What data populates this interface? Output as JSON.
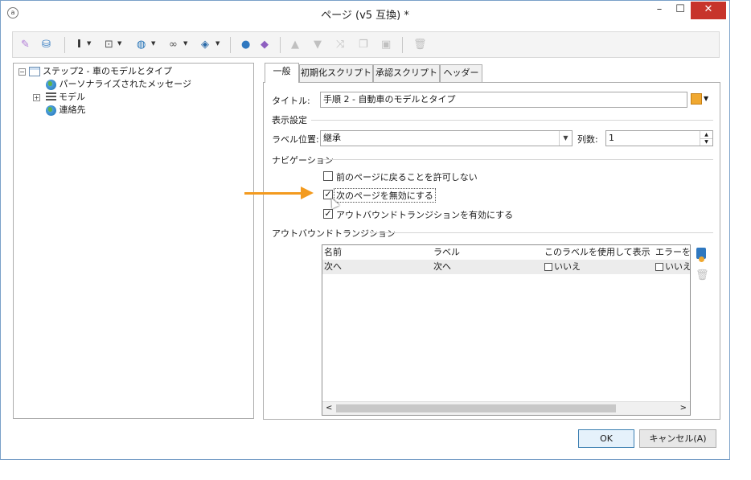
{
  "window": {
    "title": "ページ (v5 互換) *",
    "app_icon": "a",
    "minimize": "–",
    "maximize": "☐",
    "close": "✕"
  },
  "toolbar": {
    "icons": [
      "wand-icon",
      "database-icon",
      "text-cursor-icon",
      "flow-icon",
      "globe-icon",
      "link-icon",
      "stack-icon",
      "person-icon",
      "shapes-icon",
      "arrow-up-icon",
      "arrow-down-icon",
      "shuffle-icon",
      "copy-icon",
      "paste-icon",
      "trash-icon"
    ],
    "glyphs": {
      "wand": "✎",
      "database": "⛁",
      "text": "I",
      "flow": "⊡",
      "globe": "◍",
      "link": "∞",
      "stack": "◈",
      "person": "●",
      "shapes": "◆",
      "up": "▲",
      "down": "▼",
      "shuffle": "⤨",
      "copy": "❐",
      "paste": "▣",
      "trash": "🗑",
      "dd": "▼"
    }
  },
  "tree": {
    "root": {
      "label": "ステップ2 - 車のモデルとタイプ",
      "expander": "⊟"
    },
    "items": [
      {
        "label": "パーソナライズされたメッセージ"
      },
      {
        "label": "モデル",
        "expander": "+"
      },
      {
        "label": "連絡先"
      }
    ]
  },
  "tabs": [
    "一般",
    "初期化スクリプト",
    "承認スクリプト",
    "ヘッダー"
  ],
  "general": {
    "title_label": "タイトル:",
    "title_value": "手順 2 - 自動車のモデルとタイプ",
    "display_settings": "表示設定",
    "label_position_label": "ラベル位置:",
    "label_position_value": "継承",
    "columns_label": "列数:",
    "columns_value": "1",
    "navigation": "ナビゲーション",
    "nav_options": [
      {
        "label": "前のページに戻ることを許可しない",
        "checked": false
      },
      {
        "label": "次のページを無効にする",
        "checked": true
      },
      {
        "label": "アウトバウンドトランジションを有効にする",
        "checked": true
      }
    ],
    "check_mark": "✓",
    "outbound": "アウトバウンドトランジション",
    "grid": {
      "columns": [
        "名前",
        "ラベル",
        "このラベルを使用して表示",
        "エラーを無"
      ],
      "rows": [
        {
          "name": "次へ",
          "label": "次へ",
          "use_label": "いいえ",
          "error": "いいえ"
        }
      ],
      "scroll_left": "<",
      "scroll_right": ">"
    }
  },
  "buttons": {
    "ok": "OK",
    "cancel": "キャンセル(A)"
  },
  "colors": {
    "accent_arrow": "#f39a1e",
    "close_red": "#c7342b"
  }
}
